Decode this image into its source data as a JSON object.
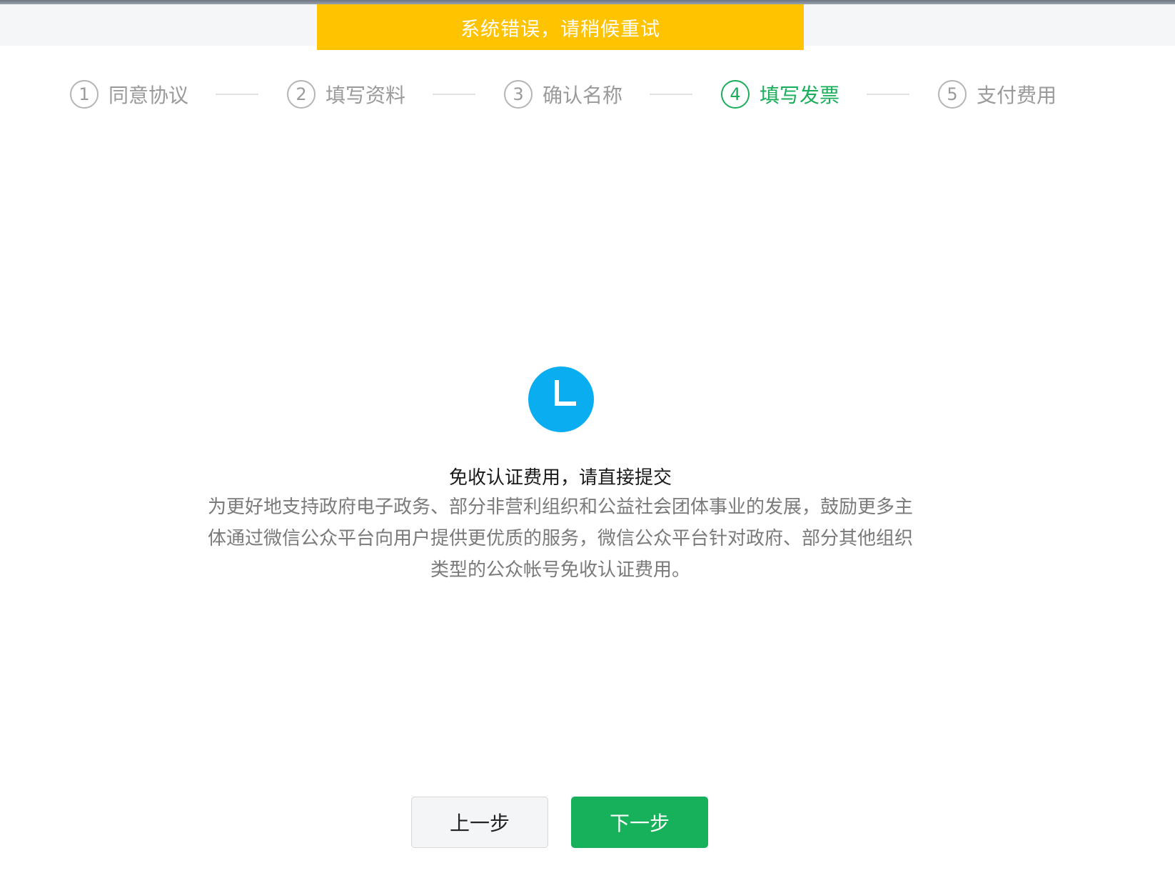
{
  "toast": {
    "message": "系统错误，请稍候重试",
    "color": "#ffc300"
  },
  "steps": [
    {
      "num": "1",
      "label": "同意协议",
      "state": "inactive"
    },
    {
      "num": "2",
      "label": "填写资料",
      "state": "inactive"
    },
    {
      "num": "3",
      "label": "确认名称",
      "state": "inactive"
    },
    {
      "num": "4",
      "label": "填写发票",
      "state": "active"
    },
    {
      "num": "5",
      "label": "支付费用",
      "state": "inactive"
    }
  ],
  "status": {
    "icon": "clock-icon",
    "icon_color": "#0aaef0",
    "title": "免收认证费用，请直接提交",
    "description": "为更好地支持政府电子政务、部分非营利组织和公益社会团体事业的发展，鼓励更多主体通过微信公众平台向用户提供更优质的服务，微信公众平台针对政府、部分其他组织类型的公众帐号免收认证费用。"
  },
  "actions": {
    "prev_label": "上一步",
    "next_label": "下一步",
    "next_color": "#17b15b"
  }
}
